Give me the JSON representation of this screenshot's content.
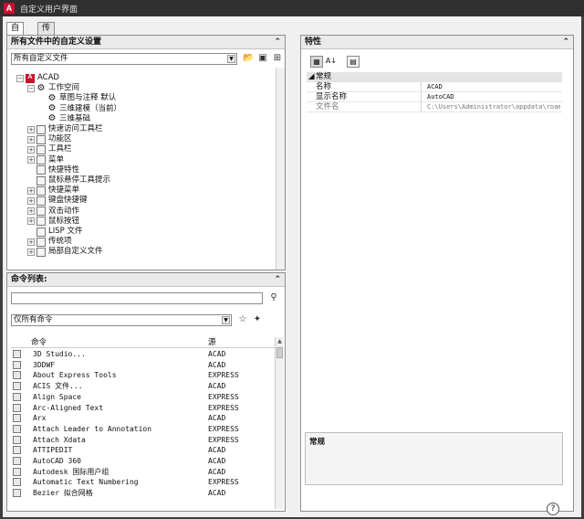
{
  "window": {
    "title": "自定义用户界面",
    "app_icon": "A"
  },
  "tabs": [
    {
      "label": "自定义",
      "active": true
    },
    {
      "label": "传输",
      "active": false
    }
  ],
  "customizations_panel": {
    "header": "所有文件中的自定义设置",
    "collapse_glyph": "⌃",
    "filter_value": "所有自定义文件",
    "tree": [
      {
        "label": "ACAD",
        "level": 0,
        "expander": "−",
        "icon": "acad",
        "glyph": "A"
      },
      {
        "label": "工作空间",
        "level": 1,
        "expander": "−",
        "icon": "gear",
        "glyph": "⚙"
      },
      {
        "label": "草图与注释 默认",
        "level": 2,
        "expander": "",
        "icon": "gear",
        "glyph": "⚙"
      },
      {
        "label": "三维建模（当前）",
        "level": 2,
        "expander": "",
        "icon": "gear",
        "glyph": "⚙"
      },
      {
        "label": "三维基础",
        "level": 2,
        "expander": "",
        "icon": "gear",
        "glyph": "⚙"
      },
      {
        "label": "快速访问工具栏",
        "level": 1,
        "expander": "+",
        "icon": "box",
        "glyph": ""
      },
      {
        "label": "功能区",
        "level": 1,
        "expander": "+",
        "icon": "box",
        "glyph": ""
      },
      {
        "label": "工具栏",
        "level": 1,
        "expander": "+",
        "icon": "box",
        "glyph": ""
      },
      {
        "label": "菜单",
        "level": 1,
        "expander": "+",
        "icon": "box",
        "glyph": ""
      },
      {
        "label": "快捷特性",
        "level": 1,
        "expander": "",
        "icon": "box",
        "glyph": ""
      },
      {
        "label": "鼠标悬停工具提示",
        "level": 1,
        "expander": "",
        "icon": "box",
        "glyph": ""
      },
      {
        "label": "快捷菜单",
        "level": 1,
        "expander": "+",
        "icon": "box",
        "glyph": ""
      },
      {
        "label": "键盘快捷键",
        "level": 1,
        "expander": "+",
        "icon": "box",
        "glyph": ""
      },
      {
        "label": "双击动作",
        "level": 1,
        "expander": "+",
        "icon": "box",
        "glyph": ""
      },
      {
        "label": "鼠标按钮",
        "level": 1,
        "expander": "+",
        "icon": "box",
        "glyph": ""
      },
      {
        "label": "LISP 文件",
        "level": 1,
        "expander": "",
        "icon": "box",
        "glyph": ""
      },
      {
        "label": "传统项",
        "level": 1,
        "expander": "+",
        "icon": "box",
        "glyph": ""
      },
      {
        "label": "局部自定义文件",
        "level": 1,
        "expander": "+",
        "icon": "box",
        "glyph": ""
      }
    ]
  },
  "command_panel": {
    "header": "命令列表:",
    "search_value": "",
    "filter_value": "仅所有命令",
    "columns": {
      "command": "命令",
      "source": "源"
    },
    "rows": [
      {
        "name": "3D Studio...",
        "source": "ACAD"
      },
      {
        "name": "3DDWF",
        "source": "ACAD"
      },
      {
        "name": "About Express Tools",
        "source": "EXPRESS"
      },
      {
        "name": "ACIS 文件...",
        "source": "ACAD"
      },
      {
        "name": "Align Space",
        "source": "EXPRESS"
      },
      {
        "name": "Arc-Aligned Text",
        "source": "EXPRESS"
      },
      {
        "name": "Arx",
        "source": "ACAD"
      },
      {
        "name": "Attach Leader to Annotation",
        "source": "EXPRESS"
      },
      {
        "name": "Attach Xdata",
        "source": "EXPRESS"
      },
      {
        "name": "ATTIPEDIT",
        "source": "ACAD"
      },
      {
        "name": "AutoCAD 360",
        "source": "ACAD"
      },
      {
        "name": "Autodesk 国际用户组",
        "source": "ACAD"
      },
      {
        "name": "Automatic Text Numbering",
        "source": "EXPRESS"
      },
      {
        "name": "Bezier 拟合网格",
        "source": "ACAD"
      }
    ]
  },
  "properties_panel": {
    "header": "特性",
    "category": "常规",
    "rows": [
      {
        "key": "名称",
        "value": "ACAD",
        "disabled": false
      },
      {
        "key": "显示名称",
        "value": "AutoCAD",
        "disabled": false
      },
      {
        "key": "文件名",
        "value": "C:\\Users\\Administrator\\appdata\\roam",
        "disabled": true
      }
    ],
    "description_title": "常规"
  },
  "footer": {
    "help_glyph": "?"
  }
}
